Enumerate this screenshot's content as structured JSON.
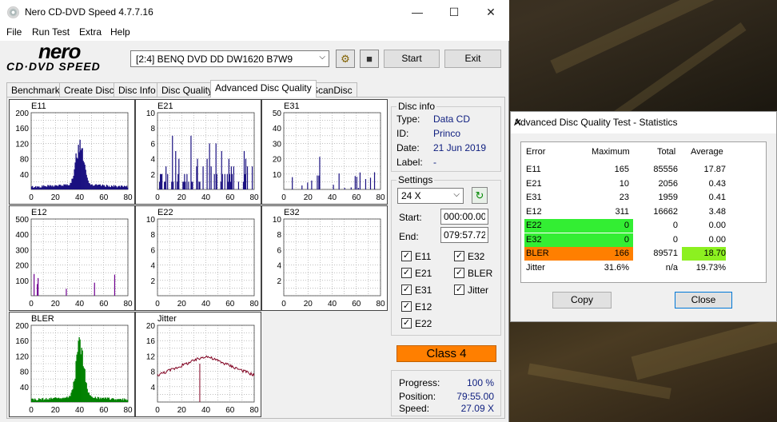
{
  "window": {
    "title": "Nero CD-DVD Speed 4.7.7.16",
    "minimize": "—",
    "maximize": "☐",
    "close": "✕"
  },
  "menu": [
    "File",
    "Run Test",
    "Extra",
    "Help"
  ],
  "logo": {
    "brand": "nero",
    "product": "CD·DVD SPEED"
  },
  "toolbar": {
    "drive": "[2:4]   BENQ DVD DD DW1620 B7W9",
    "drive_arrow": "⌵",
    "eject_icon": "⚙",
    "save_icon": "■",
    "start": "Start",
    "exit": "Exit"
  },
  "tabs": [
    "Benchmark",
    "Create Disc",
    "Disc Info",
    "Disc Quality",
    "Advanced Disc Quality",
    "ScanDisc"
  ],
  "active_tab": 4,
  "disc_info": {
    "group_title": "Disc info",
    "type_label": "Type:",
    "type": "Data CD",
    "id_label": "ID:",
    "id": "Princo",
    "date_label": "Date:",
    "date": "21 Jun 2019",
    "label_label": "Label:",
    "label": "-"
  },
  "settings": {
    "group_title": "Settings",
    "speed": "24 X",
    "refresh_icon": "↻",
    "start_label": "Start:",
    "start": "000:00.00",
    "end_label": "End:",
    "end": "079:57.72",
    "checks": [
      {
        "label": "E11",
        "checked": "✓"
      },
      {
        "label": "E32",
        "checked": "✓"
      },
      {
        "label": "E21",
        "checked": "✓"
      },
      {
        "label": "BLER",
        "checked": "✓"
      },
      {
        "label": "E31",
        "checked": "✓"
      },
      {
        "label": "Jitter",
        "checked": "✓"
      },
      {
        "label": "E12",
        "checked": "✓"
      },
      {
        "label": "E22",
        "checked": "✓"
      }
    ]
  },
  "class_badge": "Class 4",
  "progress": {
    "progress_label": "Progress:",
    "progress": "100 %",
    "position_label": "Position:",
    "position": "79:55.00",
    "speed_label": "Speed:",
    "speed": "27.09 X"
  },
  "charts": [
    {
      "name": "E11",
      "yticks": [
        "200",
        "160",
        "120",
        "80",
        "40"
      ],
      "ymax": 200,
      "color": "#1a1080",
      "shape": "peak",
      "peak": 140
    },
    {
      "name": "E21",
      "yticks": [
        "10",
        "8",
        "6",
        "4",
        "2"
      ],
      "ymax": 10,
      "color": "#1a1080",
      "shape": "spikes",
      "peak": 7
    },
    {
      "name": "E31",
      "yticks": [
        "50",
        "40",
        "30",
        "20",
        "10"
      ],
      "ymax": 50,
      "color": "#1a1080",
      "shape": "sparse",
      "peak": 23
    },
    {
      "name": "E12",
      "yticks": [
        "500",
        "400",
        "300",
        "200",
        "100"
      ],
      "ymax": 500,
      "color": "#700090",
      "shape": "sparse",
      "peak": 311
    },
    {
      "name": "E22",
      "yticks": [
        "10",
        "8",
        "6",
        "4",
        "2"
      ],
      "ymax": 10,
      "color": "#1a1080",
      "shape": "empty",
      "peak": 0
    },
    {
      "name": "E32",
      "yticks": [
        "10",
        "8",
        "6",
        "4",
        "2"
      ],
      "ymax": 10,
      "color": "#1a1080",
      "shape": "empty",
      "peak": 0
    },
    {
      "name": "BLER",
      "yticks": [
        "200",
        "160",
        "120",
        "80",
        "40"
      ],
      "ymax": 200,
      "color": "#008000",
      "shape": "peak",
      "peak": 166
    },
    {
      "name": "Jitter",
      "yticks": [
        "20",
        "16",
        "12",
        "8",
        "4"
      ],
      "ymax": 20,
      "color": "#800020",
      "shape": "jitter",
      "peak": 12
    }
  ],
  "xticks": [
    "0",
    "20",
    "40",
    "60",
    "80"
  ],
  "stats": {
    "title": "Advanced Disc Quality Test - Statistics",
    "close_icon": "✕",
    "headers": [
      "Error",
      "Maximum",
      "Total",
      "Average"
    ],
    "rows": [
      {
        "error": "E11",
        "max": "165",
        "total": "85556",
        "avg": "17.87",
        "hl": "",
        "avghl": ""
      },
      {
        "error": "E21",
        "max": "10",
        "total": "2056",
        "avg": "0.43",
        "hl": "",
        "avghl": ""
      },
      {
        "error": "E31",
        "max": "23",
        "total": "1959",
        "avg": "0.41",
        "hl": "",
        "avghl": ""
      },
      {
        "error": "E12",
        "max": "311",
        "total": "16662",
        "avg": "3.48",
        "hl": "",
        "avghl": ""
      },
      {
        "error": "E22",
        "max": "0",
        "total": "0",
        "avg": "0.00",
        "hl": "#33ee33",
        "avghl": ""
      },
      {
        "error": "E32",
        "max": "0",
        "total": "0",
        "avg": "0.00",
        "hl": "#33ee33",
        "avghl": ""
      },
      {
        "error": "BLER",
        "max": "166",
        "total": "89571",
        "avg": "18.70",
        "hl": "#ff7f00",
        "avghl": "#8cf020"
      },
      {
        "error": "Jitter",
        "max": "31.6%",
        "total": "n/a",
        "avg": "19.73%",
        "hl": "",
        "avghl": ""
      }
    ],
    "copy": "Copy",
    "close": "Close"
  }
}
